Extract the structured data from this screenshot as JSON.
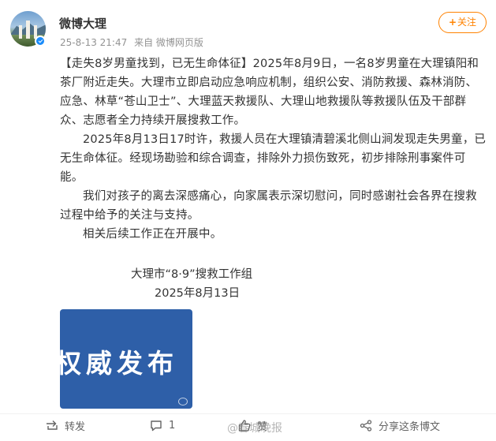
{
  "header": {
    "username": "微博大理",
    "time": "25-8-13 21:47",
    "source": "来自 微博网页版",
    "follow_label": "关注",
    "follow_plus": "+"
  },
  "post": {
    "p1_tag": "【走失8岁男童找到，已无生命体征】",
    "p1_text": "2025年8月9日，一名8岁男童在大理镇阳和茶厂附近走失。大理市立即启动应急响应机制，组织公安、消防救援、森林消防、应急、林草“苍山卫士”、大理蓝天救援队、大理山地救援队等救援队伍及干部群众、志愿者全力持续开展搜救工作。",
    "p2": "2025年8月13日17时许，救援人员在大理镇清碧溪北侧山涧发现走失男童，已无生命体征。经现场勘验和综合调查，排除外力损伤致死，初步排除刑事案件可能。",
    "p3": "我们对孩子的离去深感痛心，向家属表示深切慰问，同时感谢社会各界在搜救过程中给予的关注与支持。",
    "p4": "相关后续工作正在开展中。",
    "signature_org": "大理市“8·9”搜救工作组",
    "signature_date": "2025年8月13日"
  },
  "image": {
    "text": "权威发布",
    "bg_color": "#2e5fa8"
  },
  "footer": {
    "repost_label": "转发",
    "comment_count": "1",
    "like_label": "赞",
    "share_label": "分享这条博文",
    "watermark": "@春城晚报"
  },
  "colors": {
    "accent": "#ff8200",
    "text": "#333333",
    "meta": "#939393",
    "verified": "#1a8cfa"
  }
}
